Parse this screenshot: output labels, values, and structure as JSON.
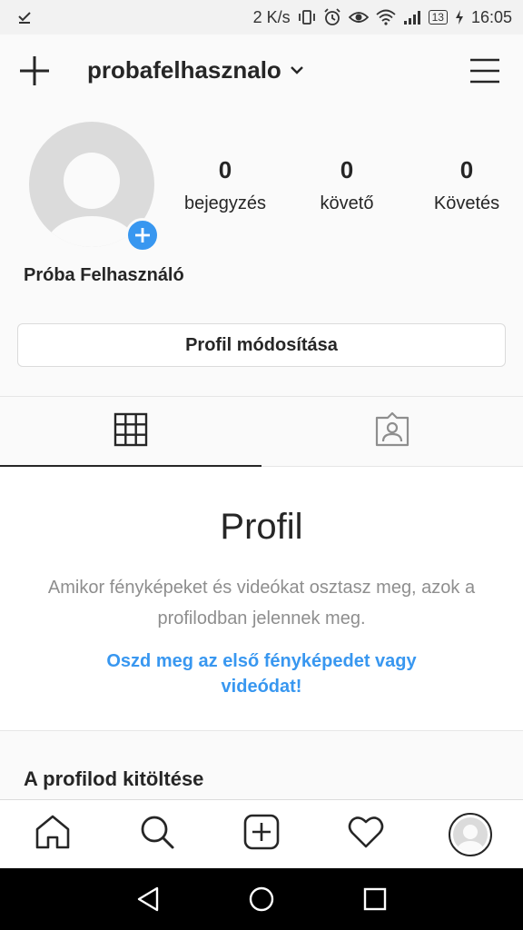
{
  "status_bar": {
    "left_icon": "download-done-icon",
    "speed": "2 K/s",
    "battery": "13",
    "time": "16:05",
    "icons": [
      "vibrate-icon",
      "alarm-icon",
      "eye-icon",
      "wifi-icon",
      "signal-icon",
      "charging-icon"
    ]
  },
  "header": {
    "username": "probafelhasznalo",
    "left_icon": "plus-icon",
    "dropdown_icon": "chevron-down-icon",
    "right_icon": "hamburger-menu-icon"
  },
  "profile": {
    "full_name": "Próba Felhasználó",
    "stats": [
      {
        "value": "0",
        "label": "bejegyzés"
      },
      {
        "value": "0",
        "label": "követő"
      },
      {
        "value": "0",
        "label": "Követés"
      }
    ],
    "edit_button_label": "Profil módosítása"
  },
  "tabs": [
    {
      "icon": "grid-icon",
      "active": true
    },
    {
      "icon": "tagged-photos-icon",
      "active": false
    }
  ],
  "empty_state": {
    "title": "Profil",
    "description": "Amikor fényképeket és videókat osztasz meg, azok a profilodban jelennek meg.",
    "cta": "Oszd meg az első fényképedet vagy videódat!"
  },
  "complete_profile": {
    "title": "A profilod kitöltése"
  },
  "bottom_nav": [
    "home-icon",
    "search-icon",
    "new-post-icon",
    "activity-heart-icon",
    "profile-avatar-icon"
  ],
  "system_nav": [
    "back-icon",
    "home-circle-icon",
    "recents-icon"
  ],
  "colors": {
    "accent": "#3897f0",
    "text": "#262626",
    "muted": "#8e8e8e",
    "border": "#dbdbdb"
  }
}
